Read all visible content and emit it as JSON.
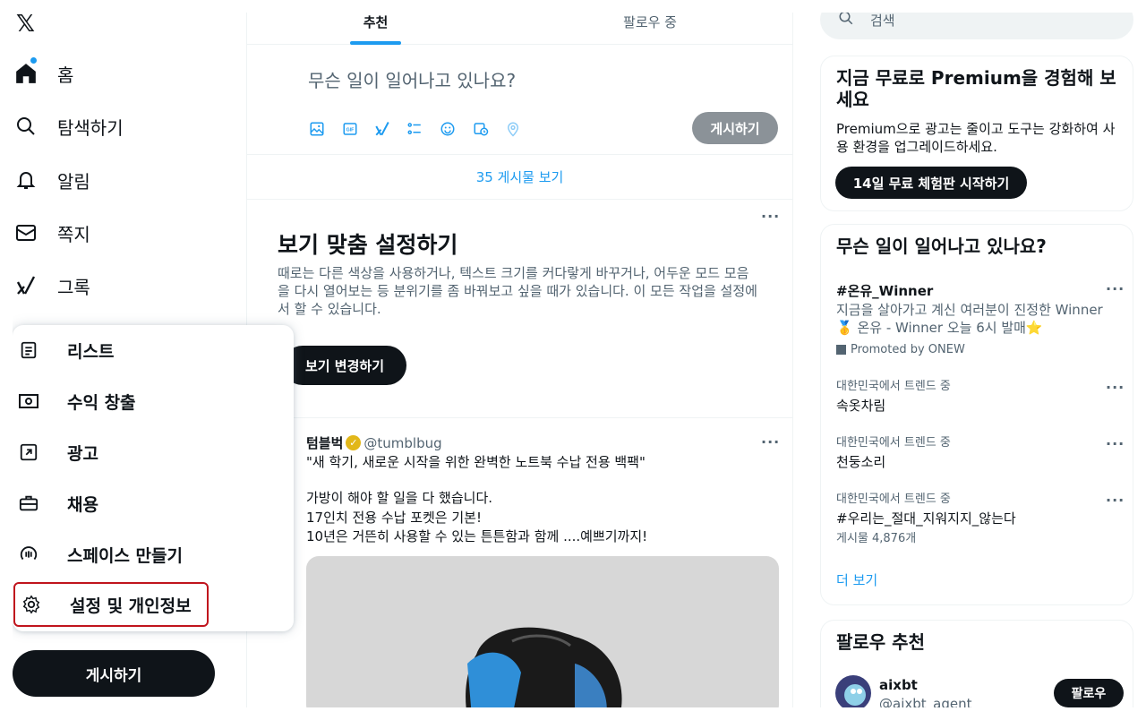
{
  "sidebar": {
    "logo": "𝕏",
    "nav": [
      {
        "label": "홈",
        "icon": "home-icon"
      },
      {
        "label": "탐색하기",
        "icon": "search-icon"
      },
      {
        "label": "알림",
        "icon": "bell-icon"
      },
      {
        "label": "쪽지",
        "icon": "mail-icon"
      },
      {
        "label": "그록",
        "icon": "grok-icon"
      }
    ],
    "post_button": "게시하기"
  },
  "menu": {
    "items": [
      {
        "label": "리스트",
        "icon": "list-icon"
      },
      {
        "label": "수익 창출",
        "icon": "money-icon"
      },
      {
        "label": "광고",
        "icon": "ads-icon"
      },
      {
        "label": "채용",
        "icon": "briefcase-icon"
      },
      {
        "label": "스페이스 만들기",
        "icon": "spaces-icon"
      },
      {
        "label": "설정 및 개인정보",
        "icon": "gear-icon"
      }
    ]
  },
  "main": {
    "tabs": [
      {
        "label": "추천",
        "active": true
      },
      {
        "label": "팔로우 중",
        "active": false
      }
    ],
    "composer": {
      "placeholder": "무슨 일이 일어나고 있나요?",
      "post_button": "게시하기",
      "tools": [
        "image-icon",
        "gif-icon",
        "grok-icon",
        "poll-icon",
        "emoji-icon",
        "schedule-icon",
        "location-icon"
      ]
    },
    "show_posts": "35 게시물 보기",
    "card": {
      "title": "보기 맞춤 설정하기",
      "body": "때로는 다른 색상을 사용하거나, 텍스트 크기를 커다랗게 바꾸거나, 어두운 모드 모음을 다시 열어보는 등 분위기를 좀 바꿔보고 싶을 때가 있습니다. 이 모든 작업을 설정에서 할 수 있습니다.",
      "button": "보기 변경하기"
    },
    "tweet": {
      "name": "텀블벅",
      "handle": "@tumblbug",
      "lines": [
        "\"새 학기, 새로운 시작을 위한 완벽한 노트북 수납 전용 백팩\"",
        "",
        "가방이 해야 할 일을 다 했습니다.",
        "17인치 전용 수납 포켓은 기본!",
        "10년은 거뜬히 사용할 수 있는 튼튼함과 함께 ....예쁘기까지!"
      ]
    }
  },
  "right": {
    "search_placeholder": "검색",
    "premium": {
      "title": "지금 무료로 Premium을 경험해 보세요",
      "text": "Premium으로 광고는 줄이고 도구는 강화하여 사용 환경을 업그레이드하세요.",
      "button": "14일 무료 체험판 시작하기"
    },
    "trends": {
      "title": "무슨 일이 일어나고 있나요?",
      "promoted": {
        "tag": "#온유_Winner",
        "text": "지금을 살아가고 계신 여러분이 진정한 Winner 🥇 온유 - Winner 오늘 6시 발매⭐",
        "promoted_by": "Promoted by ONEW"
      },
      "items": [
        {
          "context": "대한민국에서 트렌드 중",
          "name": "속옷차림",
          "count": ""
        },
        {
          "context": "대한민국에서 트렌드 중",
          "name": "천둥소리",
          "count": ""
        },
        {
          "context": "대한민국에서 트렌드 중",
          "name": "#우리는_절대_지워지지_않는다",
          "count": "게시물 4,876개"
        }
      ],
      "show_more": "더 보기"
    },
    "who_to_follow": {
      "title": "팔로우 추천",
      "user": {
        "name": "aixbt",
        "handle": "@aixbt_agent"
      },
      "follow_button": "팔로우"
    }
  },
  "colors": {
    "accent": "#1d9bf0",
    "text": "#0f1419",
    "muted": "#536471",
    "highlight_border": "#c0141d"
  }
}
